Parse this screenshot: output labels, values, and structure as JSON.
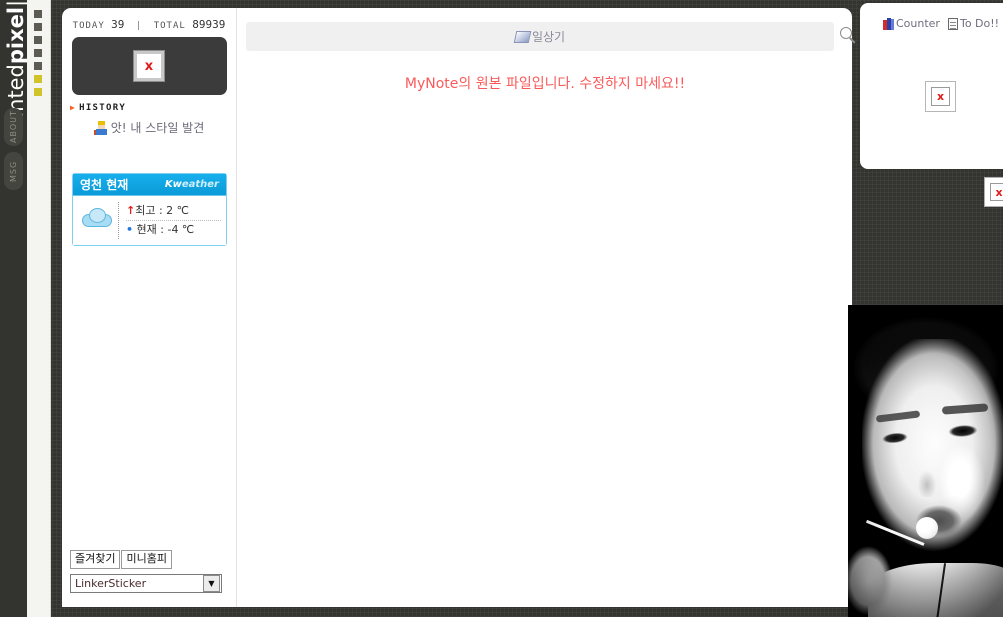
{
  "site": {
    "brand_light": "tinted",
    "brand_bold": "pixel",
    "brand_bar": "|"
  },
  "left_rail": {
    "buttons": [
      {
        "label": "ABOUT",
        "name": "about"
      },
      {
        "label": "MSG",
        "name": "msg"
      }
    ]
  },
  "dot_strip": {
    "squares": [
      {
        "color": "#5c5c54"
      },
      {
        "color": "#5c5c54"
      },
      {
        "color": "#5c5c54"
      },
      {
        "color": "#5c5c54"
      },
      {
        "color": "#5c5c54"
      },
      {
        "color": "#d1c32a"
      },
      {
        "color": "#d1c32a"
      }
    ]
  },
  "sidebar": {
    "counter": {
      "today_label": "TODAY",
      "today_value": "39",
      "separator": "|",
      "total_label": "TOTAL",
      "total_value": "89939"
    },
    "profile_image_alt": "x",
    "history_label": "HISTORY",
    "history_marker": "▶",
    "style_link": "앗! 내 스타일 발견",
    "weather": {
      "city": "영천 현재",
      "brand_kw": "Kw",
      "brand_eather": "eather",
      "high_arrow": "↑",
      "high_label": "최고 : 2 ℃",
      "now_dot": "•",
      "now_label": "현재 : -4 ℃"
    },
    "buttons": [
      {
        "label": "즐겨찾기",
        "name": "bookmark"
      },
      {
        "label": "미니홈피",
        "name": "minihompy"
      }
    ],
    "select": {
      "value": "LinkerSticker",
      "arrow": "▼"
    }
  },
  "content": {
    "header_title": "일상기",
    "notice": "MyNote의 원본 파일입니다. 수정하지 마세요!!",
    "notice_color": "#fb5a5a"
  },
  "right_panel": {
    "links": [
      {
        "label": "Counter",
        "name": "counter"
      },
      {
        "label": "To Do!!",
        "name": "todo"
      }
    ],
    "broken_image_alt": "x"
  },
  "edge_widget": {
    "broken_image_alt": "x"
  },
  "photo": {
    "alt": "black-and-white portrait of a woman with a lollipop"
  }
}
